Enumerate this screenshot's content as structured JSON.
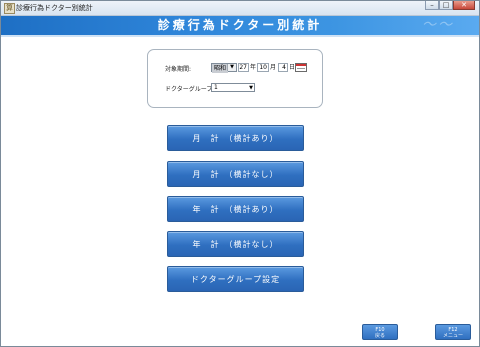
{
  "window": {
    "title": "診療行為ドクター別統計",
    "icon_glyph": "算",
    "controls": {
      "minimize": "–",
      "maximize": "□",
      "close": "✕"
    }
  },
  "header": {
    "title": "診療行為ドクター別統計"
  },
  "filters": {
    "period_label": "対象期間:",
    "era": "昭和",
    "year": "27",
    "year_unit": "年",
    "month": "10",
    "month_unit": "月",
    "day": "4",
    "day_unit": "日",
    "group_label": "ドクターグループ:",
    "group_value": "1",
    "dropdown_arrow": "▼"
  },
  "buttons": {
    "monthly_with_total": "月　計　（横計あり）",
    "monthly_without_total": "月　計　（横計なし）",
    "yearly_with_total": "年　計　（横計あり）",
    "yearly_without_total": "年　計　（横計なし）",
    "doctor_group_settings": "ドクターグループ設定"
  },
  "footer": {
    "f10_key": "F10",
    "f10_label": "戻る",
    "f12_key": "F12",
    "f12_label": "メニュー"
  },
  "colors": {
    "accent": "#2f6fc0",
    "banner": "#2f86da"
  }
}
